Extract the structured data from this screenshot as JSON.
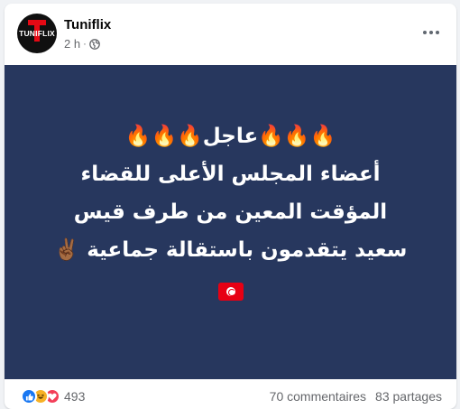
{
  "post": {
    "page_name": "Tuniflix",
    "logo_text": "TUNIFLIX",
    "time": "2 h",
    "privacy_icon": "globe-icon",
    "more_icon": "more-options-icon",
    "banner_lines": [
      "🔥🔥🔥عاجل🔥🔥🔥",
      "أعضاء المجلس الأعلى للقضاء",
      "المؤقت المعين من طرف قيس",
      "سعيد يتقدمون باستقالة جماعية ✌🏾"
    ],
    "banner_flag": "flag-tunisia",
    "reaction_count": "493",
    "comments": "70 commentaires",
    "shares": "83 partages",
    "colors": {
      "banner_bg": "#27375e",
      "logo_red": "#e50914",
      "like_blue": "#1877f2",
      "haha_yellow": "#f7b125",
      "love_red": "#f33e58"
    }
  }
}
